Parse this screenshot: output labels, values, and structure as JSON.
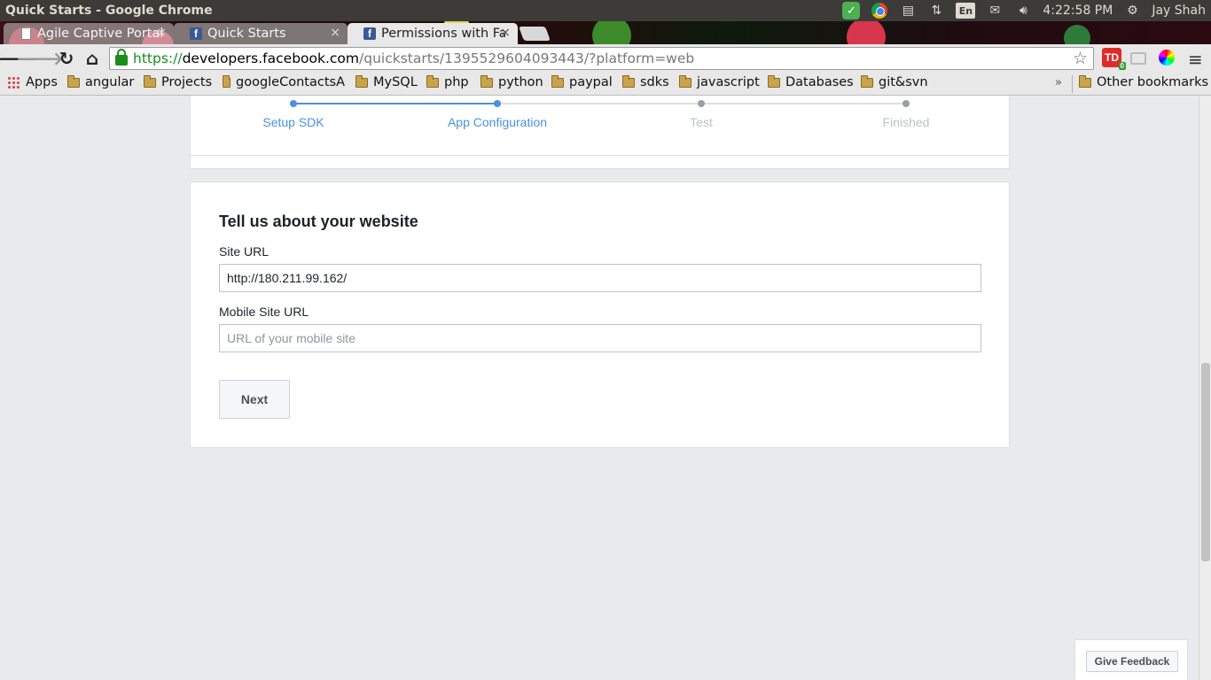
{
  "os": {
    "window_title": "Quick Starts - Google Chrome",
    "time": "4:22:58 PM",
    "user": "Jay Shah",
    "lang": "En"
  },
  "tabs": [
    {
      "label": "Agile Captive Portal",
      "favicon": "page-icon",
      "active": false
    },
    {
      "label": "Quick Starts",
      "favicon": "facebook-icon",
      "active": false
    },
    {
      "label": "Permissions with Fa",
      "favicon": "facebook-icon",
      "active": true
    }
  ],
  "omnibox": {
    "scheme": "https://",
    "host": "developers.facebook.com",
    "path": "/quickstarts/1395529604093443/?platform=web"
  },
  "extensions": {
    "todoist_label": "TD",
    "todoist_badge": "0"
  },
  "bookmarks": {
    "apps": "Apps",
    "folders": [
      "angular",
      "Projects",
      "googleContactsA",
      "MySQL",
      "php",
      "python",
      "paypal",
      "sdks",
      "javascript",
      "Databases",
      "git&svn"
    ],
    "more": "»",
    "other": "Other bookmarks"
  },
  "stepper": {
    "steps": [
      {
        "label": "Setup SDK",
        "state": "done"
      },
      {
        "label": "App Configuration",
        "state": "current"
      },
      {
        "label": "Test",
        "state": "pending"
      },
      {
        "label": "Finished",
        "state": "pending"
      }
    ],
    "active_color": "#4a90e2",
    "pending_color": "#bdc1c9"
  },
  "form": {
    "title": "Tell us about your website",
    "site_url_label": "Site URL",
    "site_url_value": "http://180.211.99.162/",
    "mobile_label": "Mobile Site URL",
    "mobile_placeholder": "URL of your mobile site",
    "next_label": "Next"
  },
  "feedback": {
    "label": "Give Feedback"
  }
}
